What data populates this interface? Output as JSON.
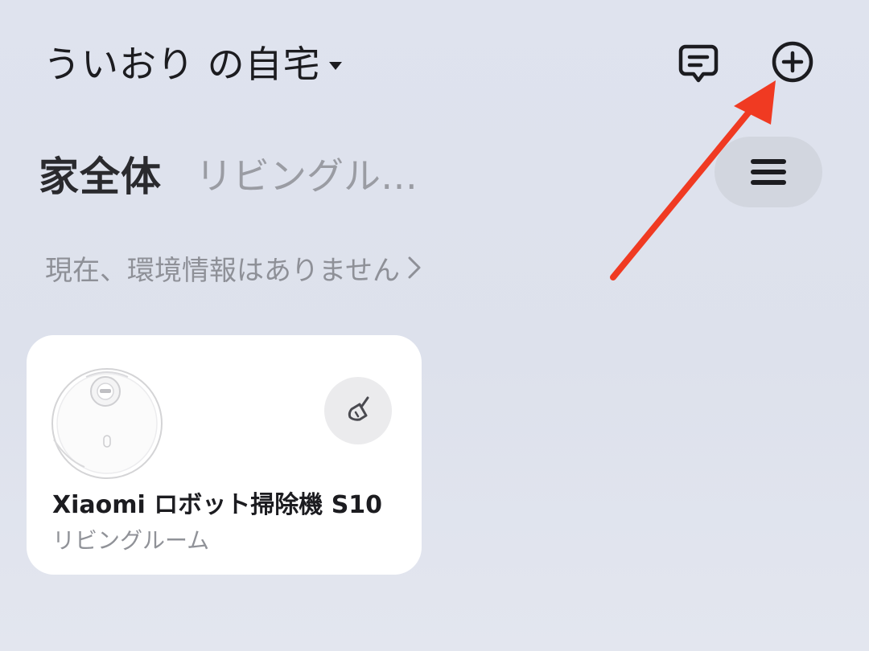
{
  "header": {
    "home_title": "ういおり の自宅",
    "icons": {
      "dropdown": "caret-down-icon",
      "messages": "message-icon",
      "add_device": "plus-circle-icon"
    }
  },
  "tabs": [
    {
      "label": "家全体",
      "active": true
    },
    {
      "label": "リビングルーム",
      "active": false
    }
  ],
  "menu": {
    "icon": "hamburger-menu-icon"
  },
  "environment": {
    "text": "現在、環境情報はありません",
    "icon": "chevron-right-icon"
  },
  "devices": [
    {
      "name": "Xiaomi ロボット掃除機 S10",
      "room": "リビングルーム",
      "image": "robot-vacuum-image",
      "action_icon": "broom-icon"
    }
  ],
  "annotation": {
    "arrow_color": "#f03a22"
  }
}
